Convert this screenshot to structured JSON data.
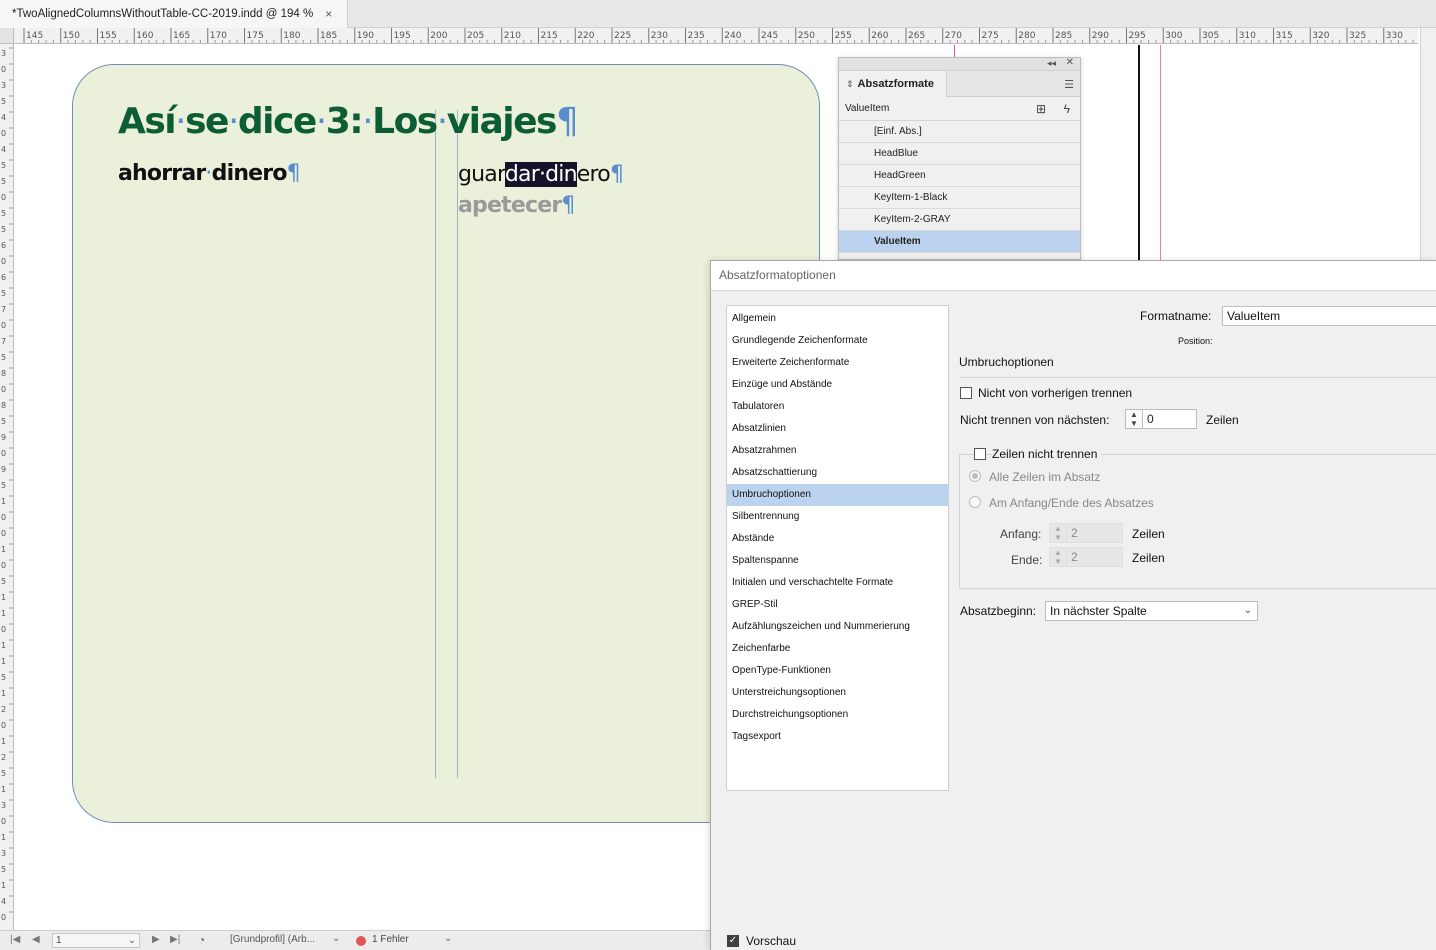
{
  "document_tab": {
    "title": "*TwoAlignedColumnsWithoutTable-CC-2019.indd @ 194 %",
    "close": "×"
  },
  "ruler": {
    "top_labels": [
      "145",
      "150",
      "155",
      "160",
      "165",
      "170",
      "175",
      "180",
      "185",
      "190",
      "195",
      "200",
      "205",
      "210",
      "215",
      "220",
      "225",
      "230",
      "235",
      "240",
      "245",
      "250",
      "255",
      "260",
      "265",
      "270",
      "275",
      "280",
      "285",
      "290",
      "295",
      "300",
      "305",
      "310",
      "315",
      "320",
      "325",
      "330"
    ],
    "left_labels": [
      "3",
      "0",
      "3",
      "5",
      "4",
      "0",
      "4",
      "5",
      "5",
      "0",
      "5",
      "5",
      "6",
      "0",
      "6",
      "5",
      "7",
      "0",
      "7",
      "5",
      "8",
      "0",
      "8",
      "5",
      "9",
      "0",
      "9",
      "5",
      "1",
      "0",
      "0",
      "1",
      "0",
      "5",
      "1",
      "1",
      "0",
      "1",
      "1",
      "5",
      "1",
      "2",
      "0",
      "1",
      "2",
      "5",
      "1",
      "3",
      "0",
      "1",
      "3",
      "5",
      "1",
      "4",
      "0"
    ]
  },
  "page": {
    "heading": [
      "Así",
      "se",
      "dice",
      "3:",
      "Los",
      "viajes"
    ],
    "pilcrow": "¶",
    "word_sep": "·",
    "left_item": [
      "ahorrar",
      "dinero"
    ],
    "right_item_pre": "guar",
    "right_item_sel": "dar·din",
    "right_item_post": "ero",
    "gray_item": "apetecer"
  },
  "status_bar": {
    "first": "|◀",
    "prev": "◀",
    "page": "1",
    "next": "▶",
    "last": "▶|",
    "profile": "[Grundprofil] (Arb...",
    "errors": "1 Fehler",
    "error_color": "#e35656"
  },
  "panel": {
    "title": "Absatzformate",
    "current": "ValueItem",
    "styles": [
      "[Einf. Abs.]",
      "HeadBlue",
      "HeadGreen",
      "KeyItem-1-Black",
      "KeyItem-2-GRAY",
      "ValueItem"
    ],
    "active_index": 5
  },
  "dialog": {
    "title": "Absatzformatoptionen",
    "categories": [
      "Allgemein",
      "Grundlegende Zeichenformate",
      "Erweiterte Zeichenformate",
      "Einzüge und Abstände",
      "Tabulatoren",
      "Absatzlinien",
      "Absatzrahmen",
      "Absatzschattierung",
      "Umbruchoptionen",
      "Silbentrennung",
      "Abstände",
      "Spaltenspanne",
      "Initialen und verschachtelte Formate",
      "GREP-Stil",
      "Aufzählungszeichen und Nummerierung",
      "Zeichenfarbe",
      "OpenType-Funktionen",
      "Unterstreichungsoptionen",
      "Durchstreichungsoptionen",
      "Tagsexport"
    ],
    "active_category": 8,
    "formatname_label": "Formatname:",
    "formatname_value": "ValueItem",
    "position_label": "Position:",
    "section_title": "Umbruchoptionen",
    "keep_prev_label": "Nicht von vorherigen trennen",
    "keep_next_label": "Nicht trennen von nächsten:",
    "keep_next_value": "0",
    "zeilen": "Zeilen",
    "keep_lines_label": "Zeilen nicht trennen",
    "all_lines_label": "Alle Zeilen im Absatz",
    "start_end_label": "Am Anfang/Ende des Absatzes",
    "start_label": "Anfang:",
    "start_value": "2",
    "end_label": "Ende:",
    "end_value": "2",
    "para_start_label": "Absatzbeginn:",
    "para_start_value": "In nächster Spalte",
    "preview_label": "Vorschau",
    "preview_checked": true
  },
  "colors": {
    "heading": "#0c5c36",
    "frame_fill": "#ebf0da",
    "selection": "#bcd3f0"
  }
}
